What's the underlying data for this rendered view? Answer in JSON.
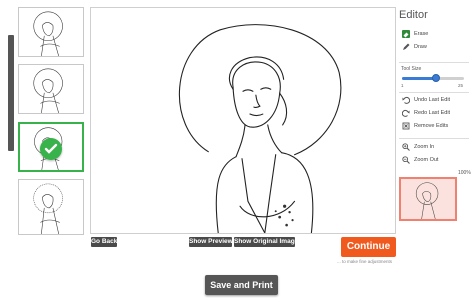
{
  "thumbnails": [
    {
      "name": "thumbnail-1",
      "selected": false
    },
    {
      "name": "thumbnail-2",
      "selected": false
    },
    {
      "name": "thumbnail-3",
      "selected": true
    },
    {
      "name": "thumbnail-4",
      "selected": false
    }
  ],
  "actions": {
    "go_back": "Go Back",
    "show_preview": "Show Preview",
    "show_original": "Show Original Image",
    "continue": "Continue",
    "hint": "... to make fine adjustments",
    "save_print": "Save and Print"
  },
  "editor": {
    "title": "Editor",
    "erase": "Erase",
    "draw": "Draw",
    "tool_size_label": "Tool Size",
    "tool_size_min": "1",
    "tool_size_max": "25",
    "tool_size_fraction": 0.55,
    "undo": "Undo Last Edit",
    "redo": "Redo Last Edit",
    "remove": "Remove Edits",
    "zoom_in": "Zoom In",
    "zoom_out": "Zoom Out",
    "zoom_level": "100%"
  },
  "colors": {
    "accent": "#f05a1e",
    "selected_border": "#38b24a",
    "slider": "#3a7bd5",
    "preview_border": "#f08070",
    "button_dark": "#4a4a4a"
  }
}
